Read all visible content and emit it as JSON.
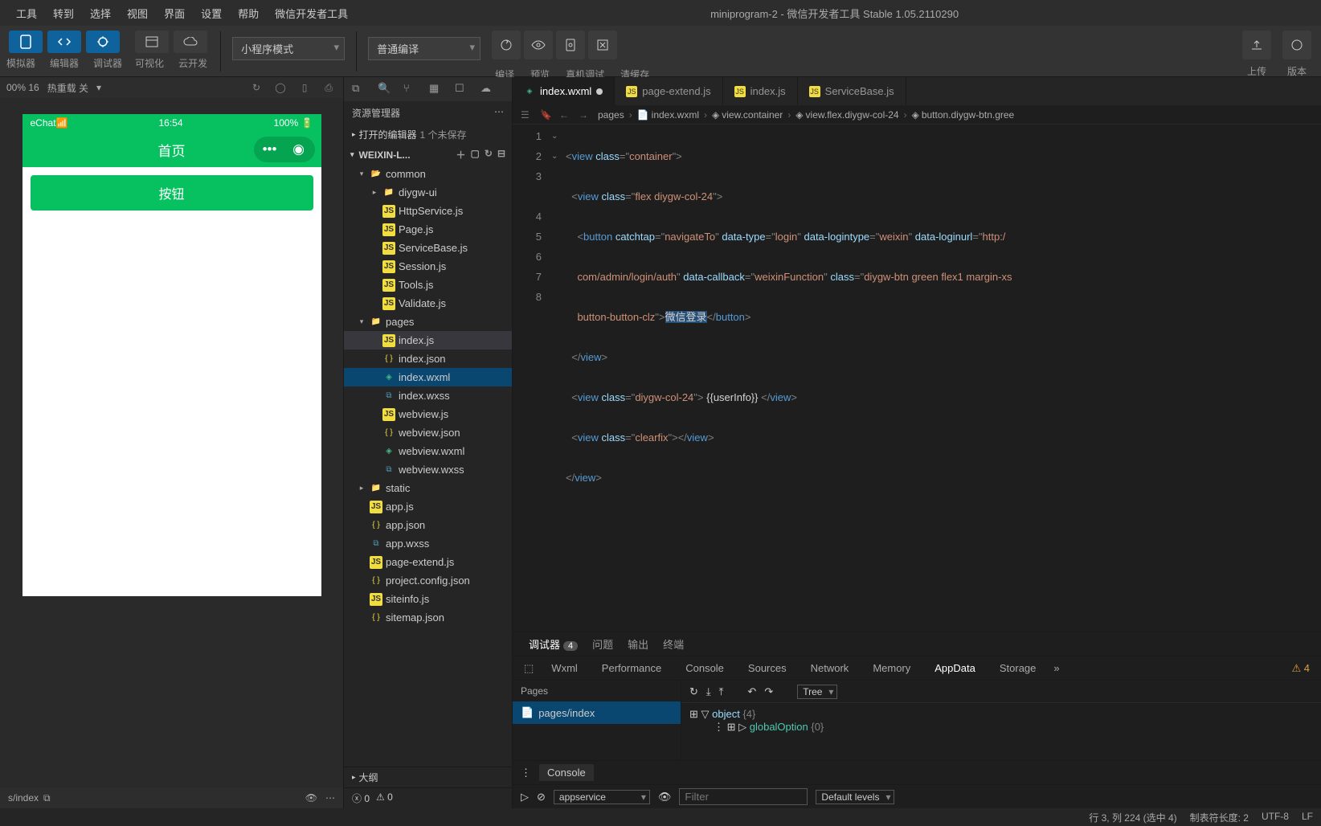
{
  "menubar": {
    "items": [
      "工具",
      "转到",
      "选择",
      "视图",
      "界面",
      "设置",
      "帮助",
      "微信开发者工具"
    ],
    "title": "miniprogram-2 - 微信开发者工具 Stable 1.05.2110290"
  },
  "toolbar": {
    "mode_labels": [
      "模拟器",
      "编辑器",
      "调试器",
      "可视化",
      "云开发"
    ],
    "dropdown1": "小程序模式",
    "dropdown2": "普通编译",
    "action_labels": [
      "编译",
      "预览",
      "真机调试",
      "清缓存"
    ],
    "right_labels": [
      "上传",
      "版本"
    ]
  },
  "simulator": {
    "zoom": "00% 16",
    "hot_reload": "热重载 关",
    "status_left": "eChat",
    "status_time": "16:54",
    "status_right": "100%",
    "nav_title": "首页",
    "button_text": "按钮",
    "footer_path": "s/index"
  },
  "explorer": {
    "title": "资源管理器",
    "open_editors": "打开的编辑器",
    "unsaved": "1 个未保存",
    "project": "WEIXIN-L...",
    "outline": "大纲",
    "tree": [
      {
        "type": "folder",
        "name": "common",
        "icon": "folder-open",
        "indent": 1,
        "chev": "▾"
      },
      {
        "type": "folder",
        "name": "diygw-ui",
        "icon": "folder",
        "indent": 2,
        "chev": "▸"
      },
      {
        "type": "file",
        "name": "HttpService.js",
        "icon": "js",
        "indent": 2
      },
      {
        "type": "file",
        "name": "Page.js",
        "icon": "js",
        "indent": 2
      },
      {
        "type": "file",
        "name": "ServiceBase.js",
        "icon": "js",
        "indent": 2
      },
      {
        "type": "file",
        "name": "Session.js",
        "icon": "js",
        "indent": 2
      },
      {
        "type": "file",
        "name": "Tools.js",
        "icon": "js",
        "indent": 2
      },
      {
        "type": "file",
        "name": "Validate.js",
        "icon": "js",
        "indent": 2
      },
      {
        "type": "folder",
        "name": "pages",
        "icon": "folder-red",
        "indent": 1,
        "chev": "▾"
      },
      {
        "type": "file",
        "name": "index.js",
        "icon": "js",
        "indent": 2,
        "selected": true
      },
      {
        "type": "file",
        "name": "index.json",
        "icon": "json",
        "indent": 2
      },
      {
        "type": "file",
        "name": "index.wxml",
        "icon": "wxml",
        "indent": 2,
        "active": true
      },
      {
        "type": "file",
        "name": "index.wxss",
        "icon": "wxss",
        "indent": 2
      },
      {
        "type": "file",
        "name": "webview.js",
        "icon": "js",
        "indent": 2
      },
      {
        "type": "file",
        "name": "webview.json",
        "icon": "json",
        "indent": 2
      },
      {
        "type": "file",
        "name": "webview.wxml",
        "icon": "wxml",
        "indent": 2
      },
      {
        "type": "file",
        "name": "webview.wxss",
        "icon": "wxss",
        "indent": 2
      },
      {
        "type": "folder",
        "name": "static",
        "icon": "folder",
        "indent": 1,
        "chev": "▸"
      },
      {
        "type": "file",
        "name": "app.js",
        "icon": "js",
        "indent": 1
      },
      {
        "type": "file",
        "name": "app.json",
        "icon": "json",
        "indent": 1
      },
      {
        "type": "file",
        "name": "app.wxss",
        "icon": "wxss",
        "indent": 1
      },
      {
        "type": "file",
        "name": "page-extend.js",
        "icon": "js",
        "indent": 1
      },
      {
        "type": "file",
        "name": "project.config.json",
        "icon": "json",
        "indent": 1
      },
      {
        "type": "file",
        "name": "siteinfo.js",
        "icon": "js",
        "indent": 1
      },
      {
        "type": "file",
        "name": "sitemap.json",
        "icon": "json",
        "indent": 1
      }
    ],
    "problems": {
      "err": "0",
      "warn": "0"
    }
  },
  "tabs": [
    {
      "name": "index.wxml",
      "icon": "wxml",
      "active": true,
      "dirty": true
    },
    {
      "name": "page-extend.js",
      "icon": "js"
    },
    {
      "name": "index.js",
      "icon": "js"
    },
    {
      "name": "ServiceBase.js",
      "icon": "js"
    }
  ],
  "breadcrumb": {
    "items": [
      "pages",
      "index.wxml",
      "view.container",
      "view.flex.diygw-col-24",
      "button.diygw-btn.gree"
    ]
  },
  "code": {
    "lines": [
      "1",
      "2",
      "3",
      "",
      "4",
      "5",
      "6",
      "7",
      "8"
    ],
    "l1_tag": "view",
    "l1_attr": "class",
    "l1_val": "container",
    "l2_tag": "view",
    "l2_attr": "class",
    "l2_val": "flex diygw-col-24",
    "l3_tag": "button",
    "l3_a1": "catchtap",
    "l3_v1": "navigateTo",
    "l3_a2": "data-type",
    "l3_v2": "login",
    "l3_a3": "data-logintype",
    "l3_v3": "weixin",
    "l3_a4": "data-loginurl",
    "l3_v4": "http:/",
    "l3b_v1": "com/admin/login/auth",
    "l3b_a2": "data-callback",
    "l3b_v2": "weixinFunction",
    "l3b_a3": "class",
    "l3b_v3": "diygw-btn green flex1 margin-xs",
    "l3c_v1": "button-button-clz",
    "l3c_txt": "微信登录",
    "l3c_close": "button",
    "l4_close": "view",
    "l5_tag": "view",
    "l5_attr": "class",
    "l5_val": "diygw-col-24",
    "l5_txt": "{{userInfo}}",
    "l5_close": "view",
    "l6_tag": "view",
    "l6_attr": "class",
    "l6_val": "clearfix",
    "l6_close": "view",
    "l7_close": "view"
  },
  "devtools": {
    "top_tabs": [
      "调试器",
      "问题",
      "输出",
      "终端"
    ],
    "top_badge": "4",
    "sub_tabs": [
      "Wxml",
      "Performance",
      "Console",
      "Sources",
      "Network",
      "Memory",
      "AppData",
      "Storage"
    ],
    "warn_badge": "4",
    "pages_hdr": "Pages",
    "pages_row": "pages/index",
    "tree_dd": "Tree",
    "obj_label": "object",
    "obj_count": "{4}",
    "obj_prop": "globalOption",
    "obj_prop_count": "{0}",
    "console_tab": "Console",
    "appservice": "appservice",
    "filter": "Filter",
    "levels": "Default levels"
  },
  "statusbar": {
    "cursor": "行 3, 列 224 (选中 4)",
    "tab": "制表符长度: 2",
    "enc": "UTF-8",
    "eol": "LF"
  }
}
